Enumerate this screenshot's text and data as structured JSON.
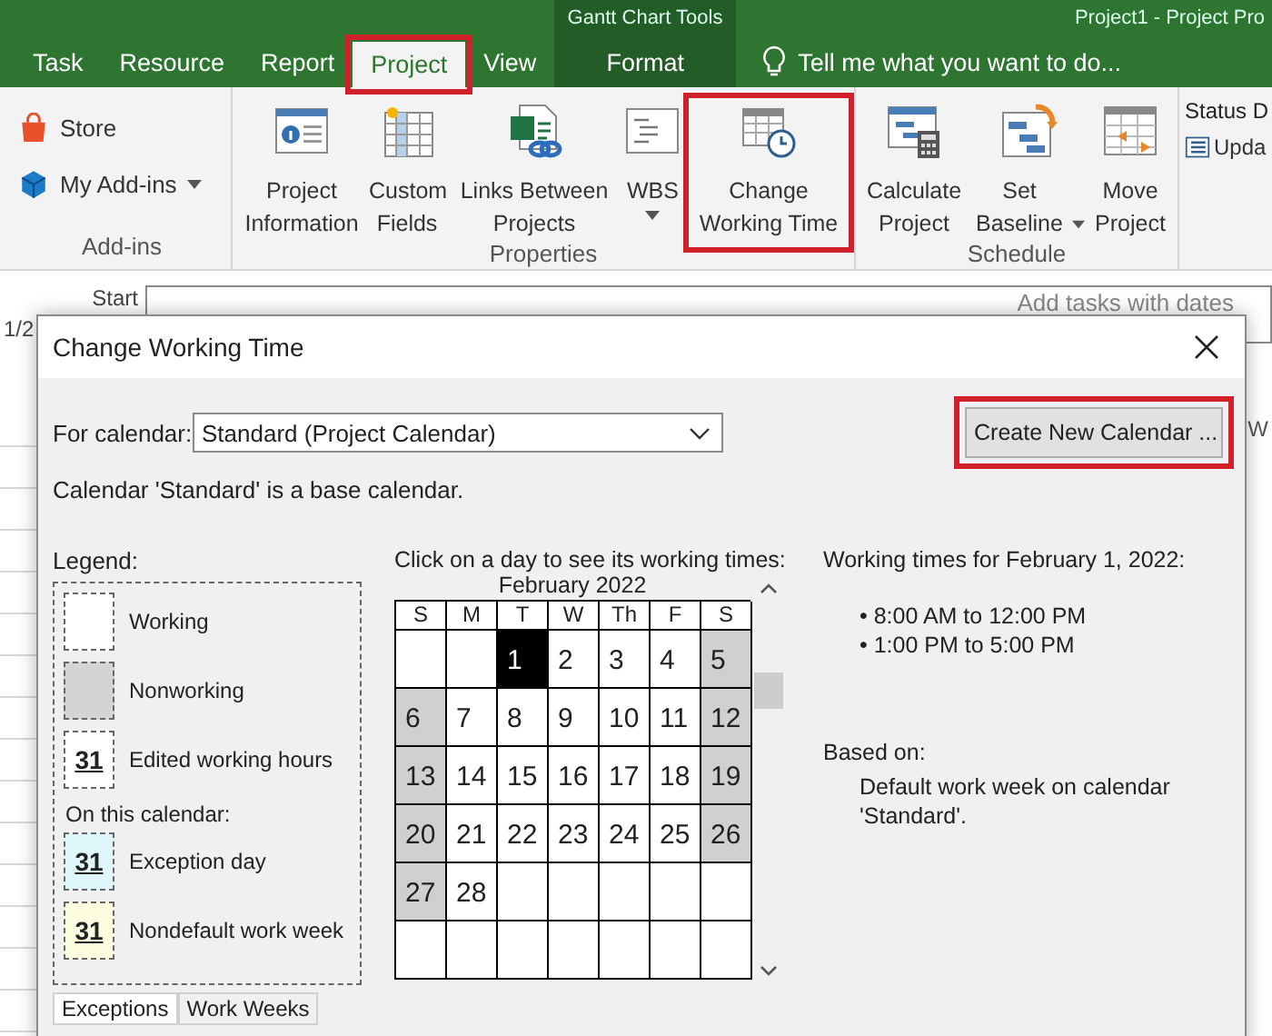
{
  "app_title": {
    "context": "Gantt Chart Tools",
    "title": "Project1 - Project Pro"
  },
  "tabs": [
    {
      "label": "Task",
      "selected": false,
      "highlighted": false,
      "kind": "normal"
    },
    {
      "label": "Resource",
      "selected": false,
      "highlighted": false,
      "kind": "normal"
    },
    {
      "label": "Report",
      "selected": false,
      "highlighted": false,
      "kind": "normal"
    },
    {
      "label": "Project",
      "selected": true,
      "highlighted": true,
      "kind": "normal"
    },
    {
      "label": "View",
      "selected": false,
      "highlighted": false,
      "kind": "normal"
    },
    {
      "label": "Format",
      "selected": false,
      "highlighted": false,
      "kind": "context"
    }
  ],
  "tell_me": "Tell me what you want to do...",
  "ribbon": {
    "groups": [
      {
        "label": "Add-ins",
        "kind": "small",
        "buttons": [
          {
            "label": "Store",
            "dropdown": false
          },
          {
            "label": "My Add-ins",
            "dropdown": true
          }
        ]
      },
      {
        "label": "Properties",
        "kind": "large",
        "buttons": [
          {
            "label": "Project Information",
            "dropdown": false,
            "highlighted": false
          },
          {
            "label": "Custom Fields",
            "dropdown": false,
            "highlighted": false
          },
          {
            "label": "Links Between Projects",
            "dropdown": false,
            "highlighted": false
          },
          {
            "label": "WBS",
            "dropdown": true,
            "highlighted": false
          },
          {
            "label": "Change Working Time",
            "dropdown": false,
            "highlighted": true
          }
        ]
      },
      {
        "label": "Schedule",
        "kind": "large",
        "buttons": [
          {
            "label": "Calculate Project",
            "dropdown": false,
            "highlighted": false
          },
          {
            "label": "Set Baseline",
            "dropdown": true,
            "highlighted": false
          },
          {
            "label": "Move Project",
            "dropdown": false,
            "highlighted": false
          }
        ]
      }
    ],
    "status": {
      "label": "Status D",
      "update": "Upda"
    }
  },
  "background": {
    "start_label": "Start",
    "date_label": "1/2",
    "timeline_hint": "Add tasks with dates",
    "column_header": "W"
  },
  "dialog": {
    "title": "Change Working Time",
    "calendar_label": "For calendar:",
    "calendar_value": "Standard (Project Calendar)",
    "create_button": {
      "label": "Create New Calendar ...",
      "highlighted": true
    },
    "base_note": "Calendar 'Standard' is a base calendar.",
    "legend": {
      "title": "Legend:",
      "items": [
        {
          "kind": "working",
          "label": "Working"
        },
        {
          "kind": "nonworking",
          "label": "Nonworking"
        },
        {
          "kind": "edited",
          "sample": "31",
          "label": "Edited working hours"
        },
        {
          "kind": "heading",
          "label": "On this calendar:"
        },
        {
          "kind": "exception",
          "sample": "31",
          "label": "Exception day"
        },
        {
          "kind": "nondefault",
          "sample": "31",
          "label": "Nondefault work week"
        }
      ]
    },
    "calendar": {
      "prompt": "Click on a day to see its working times:",
      "month": "February 2022",
      "weekdays": [
        "S",
        "M",
        "T",
        "W",
        "Th",
        "F",
        "S"
      ],
      "weeks": [
        [
          {
            "selected": false,
            "nonworking": false
          },
          {
            "selected": false,
            "nonworking": false
          },
          {
            "day": "1",
            "selected": true,
            "nonworking": false
          },
          {
            "day": "2",
            "selected": false,
            "nonworking": false
          },
          {
            "day": "3",
            "selected": false,
            "nonworking": false
          },
          {
            "day": "4",
            "selected": false,
            "nonworking": false
          },
          {
            "day": "5",
            "selected": false,
            "nonworking": true
          }
        ],
        [
          {
            "day": "6",
            "selected": false,
            "nonworking": true
          },
          {
            "day": "7",
            "selected": false,
            "nonworking": false
          },
          {
            "day": "8",
            "selected": false,
            "nonworking": false
          },
          {
            "day": "9",
            "selected": false,
            "nonworking": false
          },
          {
            "day": "10",
            "selected": false,
            "nonworking": false
          },
          {
            "day": "11",
            "selected": false,
            "nonworking": false
          },
          {
            "day": "12",
            "selected": false,
            "nonworking": true
          }
        ],
        [
          {
            "day": "13",
            "selected": false,
            "nonworking": true
          },
          {
            "day": "14",
            "selected": false,
            "nonworking": false
          },
          {
            "day": "15",
            "selected": false,
            "nonworking": false
          },
          {
            "day": "16",
            "selected": false,
            "nonworking": false
          },
          {
            "day": "17",
            "selected": false,
            "nonworking": false
          },
          {
            "day": "18",
            "selected": false,
            "nonworking": false
          },
          {
            "day": "19",
            "selected": false,
            "nonworking": true
          }
        ],
        [
          {
            "day": "20",
            "selected": false,
            "nonworking": true
          },
          {
            "day": "21",
            "selected": false,
            "nonworking": false
          },
          {
            "day": "22",
            "selected": false,
            "nonworking": false
          },
          {
            "day": "23",
            "selected": false,
            "nonworking": false
          },
          {
            "day": "24",
            "selected": false,
            "nonworking": false
          },
          {
            "day": "25",
            "selected": false,
            "nonworking": false
          },
          {
            "day": "26",
            "selected": false,
            "nonworking": true
          }
        ],
        [
          {
            "day": "27",
            "selected": false,
            "nonworking": true
          },
          {
            "day": "28",
            "selected": false,
            "nonworking": false
          },
          {
            "selected": false,
            "nonworking": false
          },
          {
            "selected": false,
            "nonworking": false
          },
          {
            "selected": false,
            "nonworking": false
          },
          {
            "selected": false,
            "nonworking": false
          },
          {
            "selected": false,
            "nonworking": false
          }
        ],
        [
          {
            "selected": false,
            "nonworking": false
          },
          {
            "selected": false,
            "nonworking": false
          },
          {
            "selected": false,
            "nonworking": false
          },
          {
            "selected": false,
            "nonworking": false
          },
          {
            "selected": false,
            "nonworking": false
          },
          {
            "selected": false,
            "nonworking": false
          },
          {
            "selected": false,
            "nonworking": false
          }
        ]
      ]
    },
    "details": {
      "heading": "Working times for February 1, 2022:",
      "times": [
        "• 8:00 AM to 12:00 PM",
        "• 1:00 PM to 5:00 PM"
      ],
      "based_on_label": "Based on:",
      "based_on": "Default work week on calendar 'Standard'."
    },
    "bottom_tabs": [
      {
        "label": "Exceptions",
        "selected": true
      },
      {
        "label": "Work Weeks",
        "selected": false
      }
    ]
  }
}
